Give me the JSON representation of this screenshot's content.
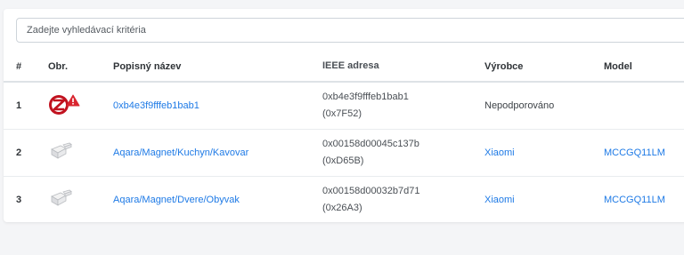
{
  "search": {
    "placeholder": "Zadejte vyhledávací kritéria"
  },
  "columns": {
    "num": "#",
    "image": "Obr.",
    "name": "Popisný název",
    "ieee": "IEEE adresa",
    "vendor": "Výrobce",
    "model": "Model"
  },
  "rows": [
    {
      "num": "1",
      "icon": "zigbee-unsupported-icon",
      "name": "0xb4e3f9fffeb1bab1",
      "ieee": "0xb4e3f9fffeb1bab1",
      "nwk": "(0x7F52)",
      "vendor": "Nepodporováno",
      "model": ""
    },
    {
      "num": "2",
      "icon": "door-sensor-icon",
      "name": "Aqara/Magnet/Kuchyn/Kavovar",
      "ieee": "0x00158d00045c137b",
      "nwk": "(0xD65B)",
      "vendor": "Xiaomi",
      "model": "MCCGQ11LM"
    },
    {
      "num": "3",
      "icon": "door-sensor-icon",
      "name": "Aqara/Magnet/Dvere/Obyvak",
      "ieee": "0x00158d00032b7d71",
      "nwk": "(0x26A3)",
      "vendor": "Xiaomi",
      "model": "MCCGQ11LM"
    }
  ],
  "colors": {
    "link": "#1e7ae6",
    "warning": "#d9252f",
    "zigbee_red": "#c1121f"
  }
}
